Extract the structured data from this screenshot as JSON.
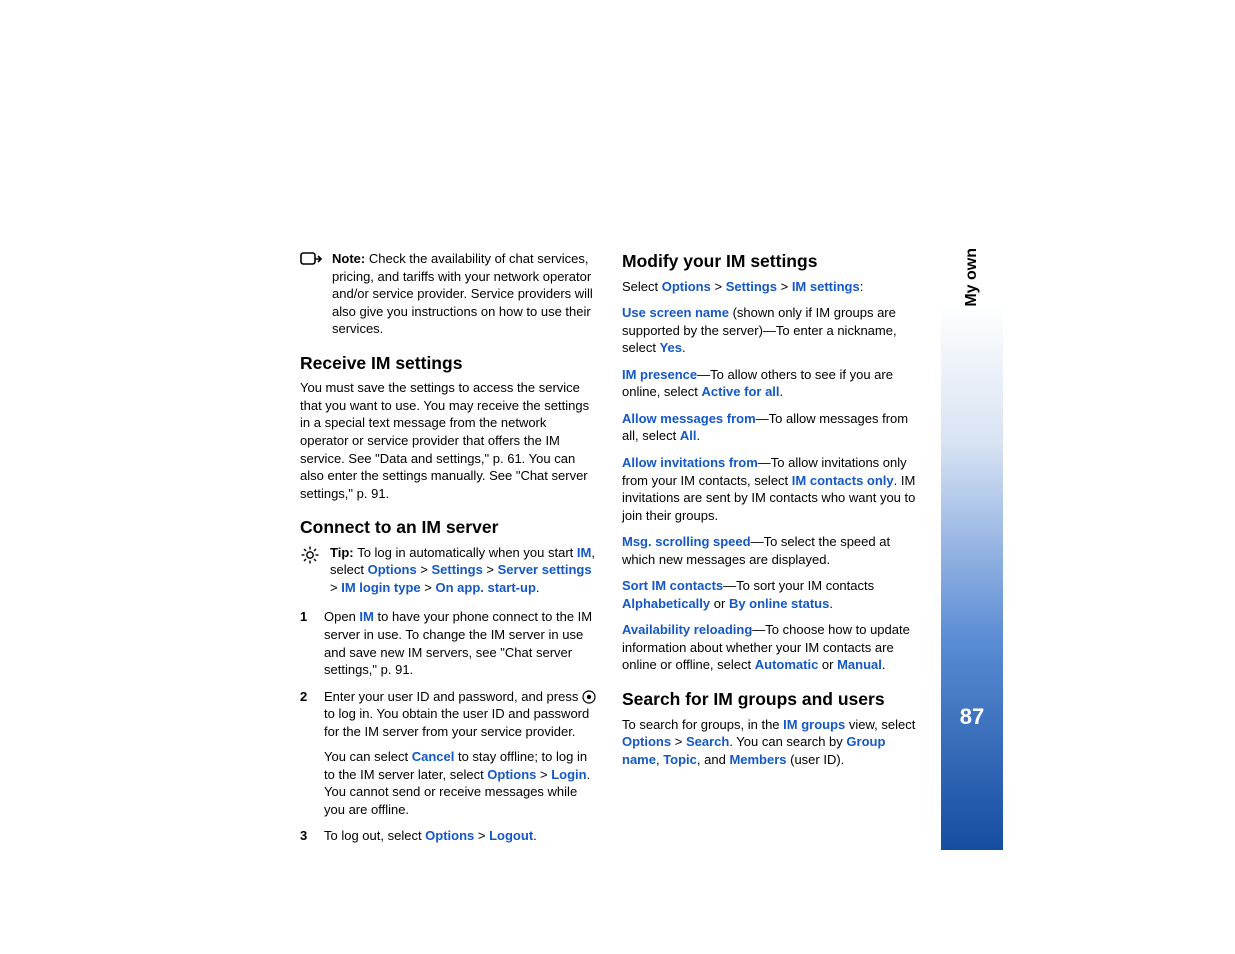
{
  "sidebar": {
    "label": "My own",
    "page": "87"
  },
  "left": {
    "note": "Check the availability of chat services, pricing, and tariffs with your network operator and/or service provider. Service providers will also give you instructions on how to use their services.",
    "h_receive": "Receive IM settings",
    "receive_p": "You must save the settings to access the service that you want to use. You may receive the settings in a special text message from the network operator or service provider that offers the IM service. See \"Data and settings,\" p. 61. You can also enter the settings manually. See \"Chat server settings,\" p. 91.",
    "h_connect": "Connect to an IM server",
    "tip_pre": "To log in automatically when you start ",
    "tip_im": "IM",
    "tip_mid1": ", select ",
    "tip_options": "Options",
    "gt": " > ",
    "tip_settings": "Settings",
    "tip_server": "Server settings",
    "tip_login_type": "IM login type",
    "tip_onapp": "On app. start-up",
    "step1_a": "Open ",
    "step1_im": "IM",
    "step1_b": " to have your phone connect to the IM server in use. To change the IM server in use and save new IM servers, see \"Chat server settings,\" p. 91.",
    "step2_a": "Enter your user ID and password, and press ",
    "step2_b": " to log in. You obtain the user ID and password for the IM server from your service provider.",
    "step2s_a": "You can select ",
    "step2s_cancel": "Cancel",
    "step2s_b": " to stay offline; to log in to the IM server later, select ",
    "step2s_login": "Login",
    "step2s_c": ". You cannot send or receive messages while you are offline.",
    "step3_a": "To log out, select ",
    "step3_logout": "Logout",
    "dot": "."
  },
  "right": {
    "h_modify": "Modify your IM settings",
    "sel_a": "Select ",
    "sel_options": "Options",
    "sel_settings": "Settings",
    "sel_im": "IM settings",
    "colon": ":",
    "p1_a": "Use screen name",
    "p1_b": " (shown only if IM groups are supported by the server)—To enter a nickname, select ",
    "p1_yes": "Yes",
    "p2_a": "IM presence",
    "p2_b": "—To allow others to see if you are online, select ",
    "p2_act": "Active for all",
    "p3_a": "Allow messages from",
    "p3_b": "—To allow messages from all, select ",
    "p3_all": "All",
    "p4_a": "Allow invitations from",
    "p4_b": "—To allow invitations only from your IM contacts, select ",
    "p4_c": "IM contacts only",
    "p4_d": ". IM invitations are sent by IM contacts who want you to join their groups.",
    "p5_a": "Msg. scrolling speed",
    "p5_b": "—To select the speed at which new messages are displayed.",
    "p6_a": "Sort IM contacts",
    "p6_b": "—To sort your IM contacts ",
    "p6_alpha": "Alphabetically",
    "p6_or": " or ",
    "p6_status": "By online status",
    "p7_a": "Availability reloading",
    "p7_b": "—To choose how to update information about whether your IM contacts are online or offline, select ",
    "p7_auto": "Automatic",
    "p7_or": " or ",
    "p7_man": "Manual",
    "h_search": "Search for IM groups and users",
    "s_a": "To search for groups, in the ",
    "s_groups": "IM groups",
    "s_b": " view, select ",
    "s_search": "Search",
    "s_c": ". You can search by ",
    "s_gname": "Group name",
    "s_comma": ", ",
    "s_topic": "Topic",
    "s_and": ", and ",
    "s_members": "Members",
    "s_d": " (user ID)."
  },
  "labels": {
    "note": "Note: ",
    "tip": "Tip: ",
    "n1": "1",
    "n2": "2",
    "n3": "3"
  }
}
